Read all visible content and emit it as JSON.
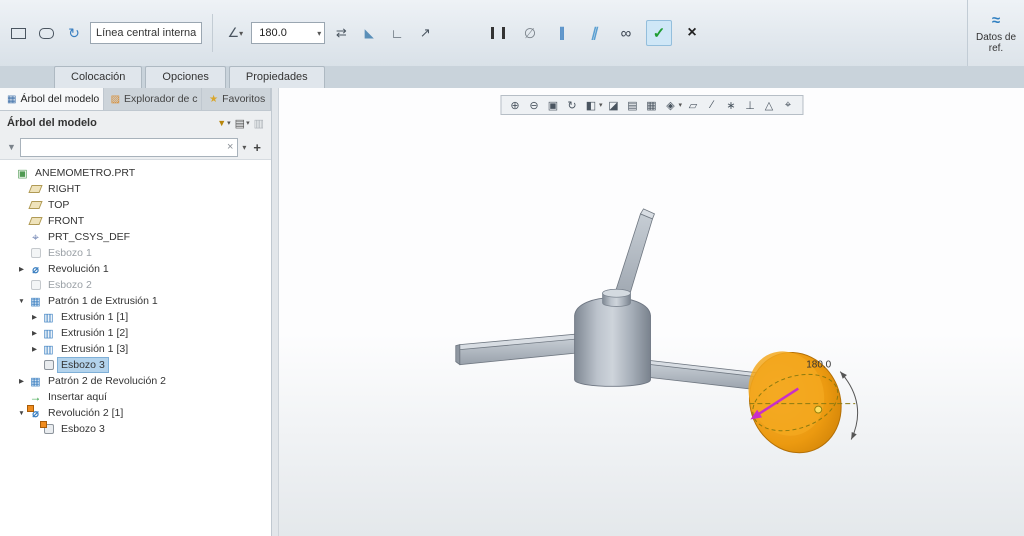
{
  "ribbon": {
    "centerline_combo": "Línea central interna",
    "angle_value": "180.0",
    "datos_ref": "Datos de ref.",
    "tabs": [
      "Colocación",
      "Opciones",
      "Propiedades"
    ]
  },
  "left_panel": {
    "tabs": [
      "Árbol del modelo",
      "Explorador de c",
      "Favoritos"
    ],
    "header_title": "Árbol del modelo",
    "filter_value": "",
    "tree": [
      {
        "label": "ANEMOMETRO.PRT",
        "indent": 0,
        "arrow": null,
        "icon": "part"
      },
      {
        "label": "RIGHT",
        "indent": 1,
        "arrow": null,
        "icon": "datum-plane"
      },
      {
        "label": "TOP",
        "indent": 1,
        "arrow": null,
        "icon": "datum-plane"
      },
      {
        "label": "FRONT",
        "indent": 1,
        "arrow": null,
        "icon": "datum-plane"
      },
      {
        "label": "PRT_CSYS_DEF",
        "indent": 1,
        "arrow": null,
        "icon": "csys"
      },
      {
        "label": "Esbozo 1",
        "indent": 1,
        "arrow": null,
        "icon": "sketch",
        "state": "dimmed"
      },
      {
        "label": "Revolución 1",
        "indent": 1,
        "arrow": "right",
        "icon": "revolve"
      },
      {
        "label": "Esbozo 2",
        "indent": 1,
        "arrow": null,
        "icon": "sketch",
        "state": "dimmed"
      },
      {
        "label": "Patrón 1 de Extrusión 1",
        "indent": 1,
        "arrow": "down",
        "icon": "pattern"
      },
      {
        "label": "Extrusión 1 [1]",
        "indent": 2,
        "arrow": "right",
        "icon": "extrude"
      },
      {
        "label": "Extrusión 1 [2]",
        "indent": 2,
        "arrow": "right",
        "icon": "extrude"
      },
      {
        "label": "Extrusión 1 [3]",
        "indent": 2,
        "arrow": "right",
        "icon": "extrude"
      },
      {
        "label": "Esbozo 3",
        "indent": 2,
        "arrow": null,
        "icon": "sketch",
        "state": "selected"
      },
      {
        "label": "Patrón 2 de Revolución 2",
        "indent": 1,
        "arrow": "right",
        "icon": "pattern"
      },
      {
        "label": "Insertar aquí",
        "indent": 1,
        "arrow": null,
        "icon": "insert"
      },
      {
        "label": "Revolución 2 [1]",
        "indent": 1,
        "arrow": "down",
        "icon": "revolve",
        "badge": true
      },
      {
        "label": "Esbozo 3",
        "indent": 2,
        "arrow": null,
        "icon": "sketch",
        "badge": true
      }
    ]
  },
  "viewport": {
    "dimension_label": "180.0",
    "toolbar_icons": [
      {
        "name": "zoom-in",
        "glyph": "⊕"
      },
      {
        "name": "zoom-out",
        "glyph": "⊖"
      },
      {
        "name": "refit",
        "glyph": "▣"
      },
      {
        "name": "repaint",
        "glyph": "↻"
      },
      {
        "name": "display-style",
        "glyph": "◧",
        "caret": true
      },
      {
        "name": "section-view",
        "glyph": "◪"
      },
      {
        "name": "capture",
        "glyph": "▤"
      },
      {
        "name": "view-manager",
        "glyph": "▦"
      },
      {
        "name": "datum-display",
        "glyph": "◈",
        "caret": true
      },
      {
        "name": "plane-display",
        "glyph": "▱"
      },
      {
        "name": "axis-display",
        "glyph": "∕"
      },
      {
        "name": "point-display",
        "glyph": "∗"
      },
      {
        "name": "csys-display",
        "glyph": "⊥"
      },
      {
        "name": "annotation-display",
        "glyph": "△"
      },
      {
        "name": "spin-center",
        "glyph": "⌖"
      }
    ]
  },
  "colors": {
    "accent_orange": "#ee9b0c",
    "selection_blue": "#b3d3ec",
    "drag_magenta": "#c92ec9",
    "accept_green": "#1f9d33"
  }
}
